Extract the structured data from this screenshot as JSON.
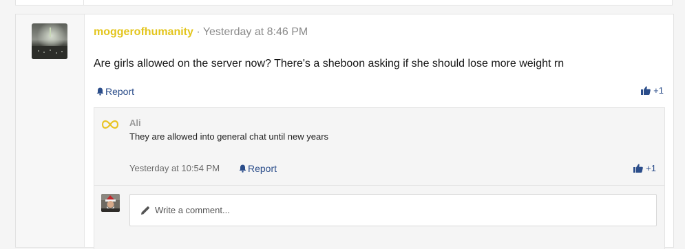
{
  "post": {
    "username": "moggerofhumanity",
    "separator": "·",
    "time": "Yesterday at 8:46 PM",
    "body": "Are girls allowed on the server now? There's a sheboon asking if she should lose more weight rn",
    "report_label": "Report",
    "like_count": "+1"
  },
  "comment": {
    "author": "Ali",
    "text": "They are allowed into general chat until new years",
    "time": "Yesterday at 10:54 PM",
    "report_label": "Report",
    "like_count": "+1"
  },
  "reply_box": {
    "placeholder": "Write a comment..."
  },
  "colors": {
    "username": "#e3c51d",
    "link": "#2b4d8a",
    "muted": "#8a8a8a"
  },
  "icons": {
    "report": "bell-icon",
    "like": "thumbs-up-icon",
    "write": "pencil-icon",
    "comment_avatar": "infinity-icon"
  }
}
